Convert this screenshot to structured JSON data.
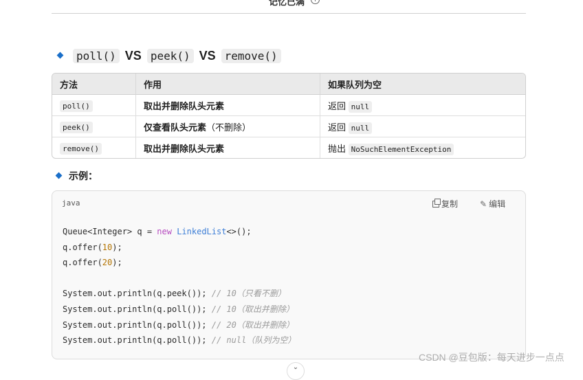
{
  "topbar": {
    "title": "记忆已满",
    "info_icon": "info-icon"
  },
  "heading": {
    "a": "poll()",
    "vs1": "VS",
    "b": "peek()",
    "vs2": "VS",
    "c": "remove()"
  },
  "table": {
    "headers": [
      "方法",
      "作用",
      "如果队列为空"
    ],
    "rows": [
      {
        "method": "poll()",
        "effect": "取出并删除队头元素",
        "effect_extra": "",
        "empty_prefix": "返回",
        "empty_code": "null"
      },
      {
        "method": "peek()",
        "effect": "仅查看队头元素",
        "effect_extra": "（不删除）",
        "empty_prefix": "返回",
        "empty_code": "null"
      },
      {
        "method": "remove()",
        "effect": "取出并删除队头元素",
        "effect_extra": "",
        "empty_prefix": "抛出",
        "empty_code": "NoSuchElementException"
      }
    ]
  },
  "example": {
    "label": "示例："
  },
  "code": {
    "lang": "java",
    "copy_label": "复制",
    "edit_label": "编辑",
    "l1a": "Queue<Integer> q = ",
    "l1kw": "new",
    "l1sp": " ",
    "l1cls": "LinkedList",
    "l1b": "<>();",
    "l2a": "q.offer(",
    "l2n": "10",
    "l2b": ");",
    "l3a": "q.offer(",
    "l3n": "20",
    "l3b": ");",
    "l5a": "System.out.println(q.peek()); ",
    "l5c": "// 10（只看不删）",
    "l6a": "System.out.println(q.poll()); ",
    "l6c": "// 10（取出并删除）",
    "l7a": "System.out.println(q.poll()); ",
    "l7c": "// 20（取出并删除）",
    "l8a": "System.out.println(q.poll()); ",
    "l8c": "// null（队列为空）"
  },
  "watermark": "CSDN @豆包版：每天进步一点点",
  "colors": {
    "accent": "#1a6fc9",
    "keyword": "#b64cc0",
    "class": "#3d7ed6",
    "number": "#b37300",
    "comment": "#9a9a9a"
  }
}
